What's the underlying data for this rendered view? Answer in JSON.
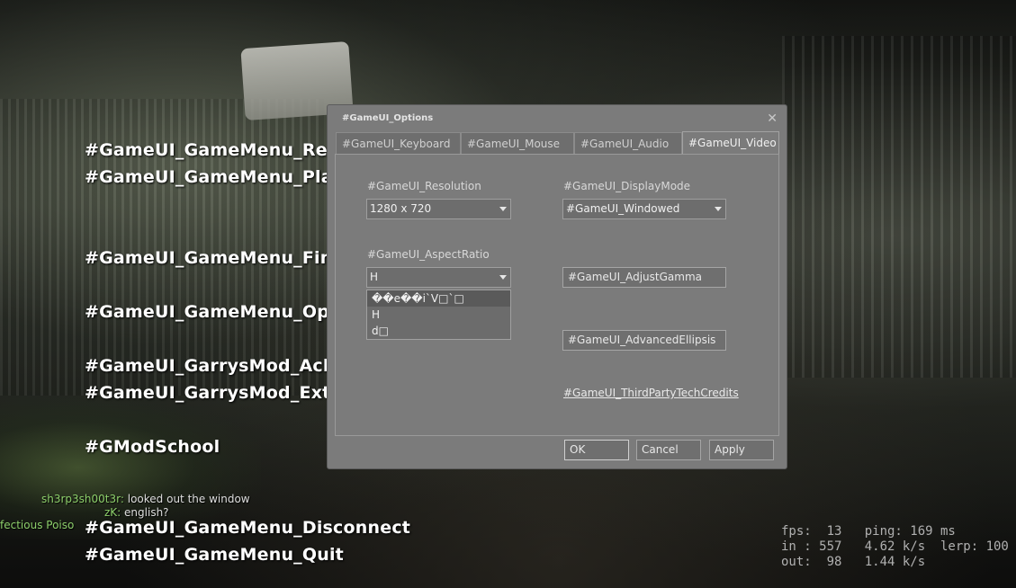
{
  "main_menu": {
    "items": [
      "#GameUI_GameMenu_Resu",
      "#GameUI_GameMenu_Playe",
      "#GameUI_GameMenu_FindS",
      "#GameUI_GameMenu_Optio",
      "#GameUI_GarrysMod_Achie",
      "#GameUI_GarrysMod_Exten",
      "#GModSchool",
      "#GameUI_GameMenu_Disconnect",
      "#GameUI_GameMenu_Quit"
    ]
  },
  "chat": {
    "lines": [
      {
        "name": "sh3rp3sh00t3r:",
        "message": "looked out the window"
      },
      {
        "name": "zK:",
        "message": "english?"
      },
      {
        "name": "fectious Poiso",
        "message": ""
      }
    ]
  },
  "net_graph": {
    "line1": "fps:  13   ping: 169 ms",
    "line2": "in : 557   4.62 k/s  lerp: 100",
    "line3": "out:  98   1.44 k/s"
  },
  "dialog": {
    "title": "#GameUI_Options",
    "close_glyph": "✕",
    "tabs": [
      "#GameUI_Keyboard",
      "#GameUI_Mouse",
      "#GameUI_Audio",
      "#GameUI_Video"
    ],
    "active_tab": "#GameUI_Video",
    "resolution": {
      "label": "#GameUI_Resolution",
      "value": "1280 x 720"
    },
    "display_mode": {
      "label": "#GameUI_DisplayMode",
      "value": "#GameUI_Windowed"
    },
    "aspect_ratio": {
      "label": "#GameUI_AspectRatio",
      "value": "H",
      "options": [
        "��e��i`V□`□",
        "H",
        "d□"
      ]
    },
    "adjust_gamma_label": "#GameUI_AdjustGamma",
    "advanced_label": "#GameUI_AdvancedEllipsis",
    "credits_link": "#GameUI_ThirdPartyTechCredits",
    "buttons": {
      "ok": "OK",
      "cancel": "Cancel",
      "apply": "Apply"
    }
  },
  "colors": {
    "dialog_bg": "#7b7b7b",
    "menu_text": "#ffffff",
    "chat_name": "#8dcf6b"
  }
}
